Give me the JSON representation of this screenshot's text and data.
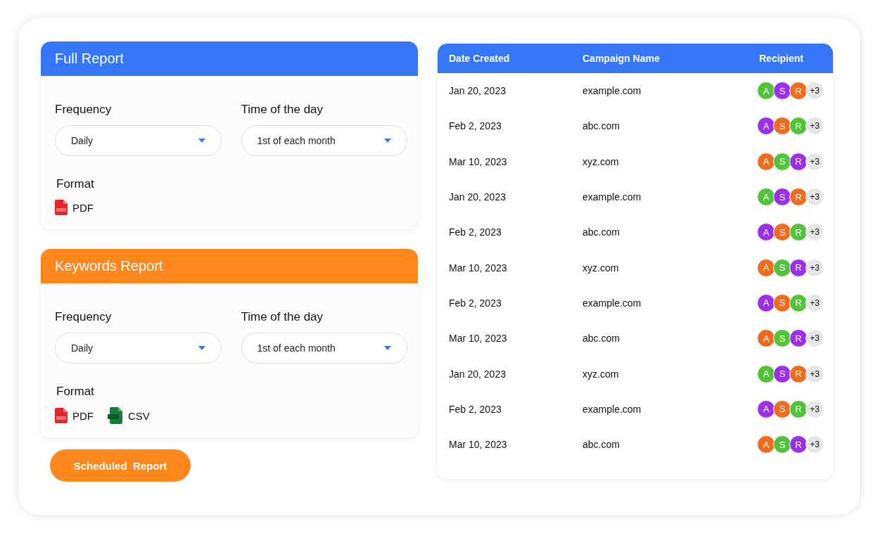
{
  "reports": [
    {
      "title": "Full Report",
      "color": "#3576f6",
      "frequency": {
        "label": "Frequency",
        "value": "Daily"
      },
      "time": {
        "label": "Time of the day",
        "value": "1st of each month"
      },
      "format_label": "Format",
      "formats": [
        {
          "kind": "pdf",
          "label": "PDF"
        }
      ]
    },
    {
      "title": "Keywords Report",
      "color": "#ff871c",
      "frequency": {
        "label": "Frequency",
        "value": "Daily"
      },
      "time": {
        "label": "Time of the day",
        "value": "1st of each month"
      },
      "format_label": "Format",
      "formats": [
        {
          "kind": "pdf",
          "label": "PDF"
        },
        {
          "kind": "csv",
          "label": "CSV"
        }
      ]
    }
  ],
  "schedule_button": "Scheduled  Report",
  "table": {
    "columns": [
      "Date Created",
      "Campaign Name",
      "Recipient"
    ],
    "rows": [
      {
        "date": "Jan 20, 2023",
        "campaign": "example.com",
        "recipients": [
          {
            "initial": "A",
            "color": "#52c23a"
          },
          {
            "initial": "S",
            "color": "#9b30e8"
          },
          {
            "initial": "R",
            "color": "#ef6c1e"
          }
        ],
        "more": "+3"
      },
      {
        "date": "Feb 2, 2023",
        "campaign": "abc.com",
        "recipients": [
          {
            "initial": "A",
            "color": "#9b30e8"
          },
          {
            "initial": "S",
            "color": "#ef6c1e"
          },
          {
            "initial": "R",
            "color": "#52c23a"
          }
        ],
        "more": "+3"
      },
      {
        "date": "Mar 10, 2023",
        "campaign": "xyz.com",
        "recipients": [
          {
            "initial": "A",
            "color": "#ef6c1e"
          },
          {
            "initial": "S",
            "color": "#52c23a"
          },
          {
            "initial": "R",
            "color": "#9b30e8"
          }
        ],
        "more": "+3"
      },
      {
        "date": "Jan 20, 2023",
        "campaign": "example.com",
        "recipients": [
          {
            "initial": "A",
            "color": "#52c23a"
          },
          {
            "initial": "S",
            "color": "#9b30e8"
          },
          {
            "initial": "R",
            "color": "#ef6c1e"
          }
        ],
        "more": "+3"
      },
      {
        "date": "Feb 2, 2023",
        "campaign": "abc.com",
        "recipients": [
          {
            "initial": "A",
            "color": "#9b30e8"
          },
          {
            "initial": "S",
            "color": "#ef6c1e"
          },
          {
            "initial": "R",
            "color": "#52c23a"
          }
        ],
        "more": "+3"
      },
      {
        "date": "Mar 10, 2023",
        "campaign": "xyz.com",
        "recipients": [
          {
            "initial": "A",
            "color": "#ef6c1e"
          },
          {
            "initial": "S",
            "color": "#52c23a"
          },
          {
            "initial": "R",
            "color": "#9b30e8"
          }
        ],
        "more": "+3"
      },
      {
        "date": "Feb 2, 2023",
        "campaign": "example.com",
        "recipients": [
          {
            "initial": "A",
            "color": "#9b30e8"
          },
          {
            "initial": "S",
            "color": "#ef6c1e"
          },
          {
            "initial": "R",
            "color": "#52c23a"
          }
        ],
        "more": "+3"
      },
      {
        "date": "Mar 10, 2023",
        "campaign": "abc.com",
        "recipients": [
          {
            "initial": "A",
            "color": "#ef6c1e"
          },
          {
            "initial": "S",
            "color": "#52c23a"
          },
          {
            "initial": "R",
            "color": "#9b30e8"
          }
        ],
        "more": "+3"
      },
      {
        "date": "Jan 20, 2023",
        "campaign": "xyz.com",
        "recipients": [
          {
            "initial": "A",
            "color": "#52c23a"
          },
          {
            "initial": "S",
            "color": "#9b30e8"
          },
          {
            "initial": "R",
            "color": "#ef6c1e"
          }
        ],
        "more": "+3"
      },
      {
        "date": "Feb 2, 2023",
        "campaign": "example.com",
        "recipients": [
          {
            "initial": "A",
            "color": "#9b30e8"
          },
          {
            "initial": "S",
            "color": "#ef6c1e"
          },
          {
            "initial": "R",
            "color": "#52c23a"
          }
        ],
        "more": "+3"
      },
      {
        "date": "Mar 10, 2023",
        "campaign": "abc.com",
        "recipients": [
          {
            "initial": "A",
            "color": "#ef6c1e"
          },
          {
            "initial": "S",
            "color": "#52c23a"
          },
          {
            "initial": "R",
            "color": "#9b30e8"
          }
        ],
        "more": "+3"
      }
    ]
  }
}
